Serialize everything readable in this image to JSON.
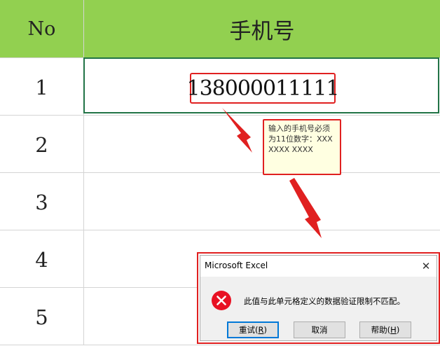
{
  "sheet": {
    "columns": {
      "no": "No",
      "phone": "手机号"
    },
    "rows": [
      "1",
      "2",
      "3",
      "4",
      "5"
    ],
    "cell_value": "138000011111",
    "header_color": "#92D050"
  },
  "tooltip": {
    "text": "输入的手机号必须为11位数字：XXX XXXX XXXX"
  },
  "dialog": {
    "title": "Microsoft Excel",
    "message": "此值与此单元格定义的数据验证限制不匹配。",
    "buttons": {
      "retry": {
        "label": "重试(",
        "key": "R",
        "suffix": ")"
      },
      "cancel": {
        "label": "取消"
      },
      "help": {
        "label": "帮助(",
        "key": "H",
        "suffix": ")"
      }
    },
    "icon": "error-icon",
    "accent": "#e02020"
  }
}
